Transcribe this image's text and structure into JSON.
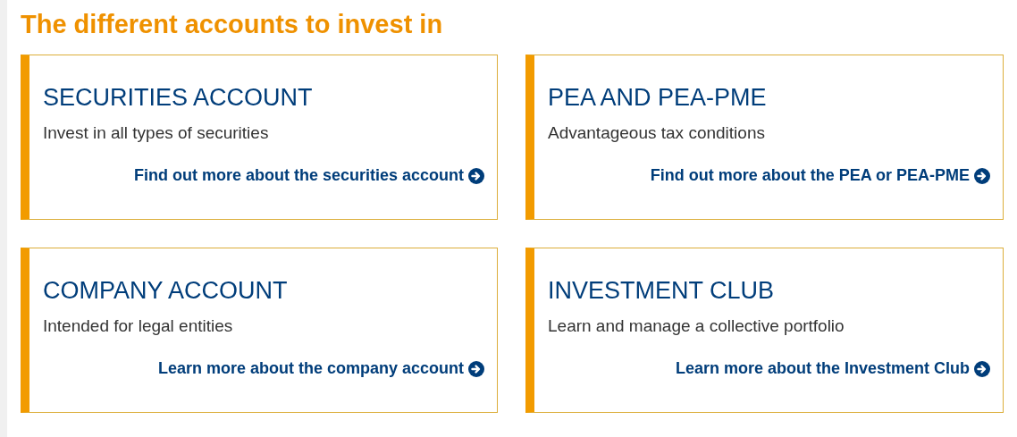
{
  "heading": "The different accounts to invest in",
  "accounts": [
    {
      "title": "SECURITIES ACCOUNT",
      "description": "Invest in all types of securities",
      "link": "Find out more about the securities account"
    },
    {
      "title": "PEA AND PEA-PME",
      "description": "Advantageous tax conditions",
      "link": "Find out more about the PEA or PEA-PME"
    },
    {
      "title": "COMPANY ACCOUNT",
      "description": "Intended for legal entities",
      "link": "Learn more about the company account"
    },
    {
      "title": "INVESTMENT CLUB",
      "description": "Learn and manage a collective portfolio",
      "link": "Learn more about the Investment Club"
    }
  ]
}
